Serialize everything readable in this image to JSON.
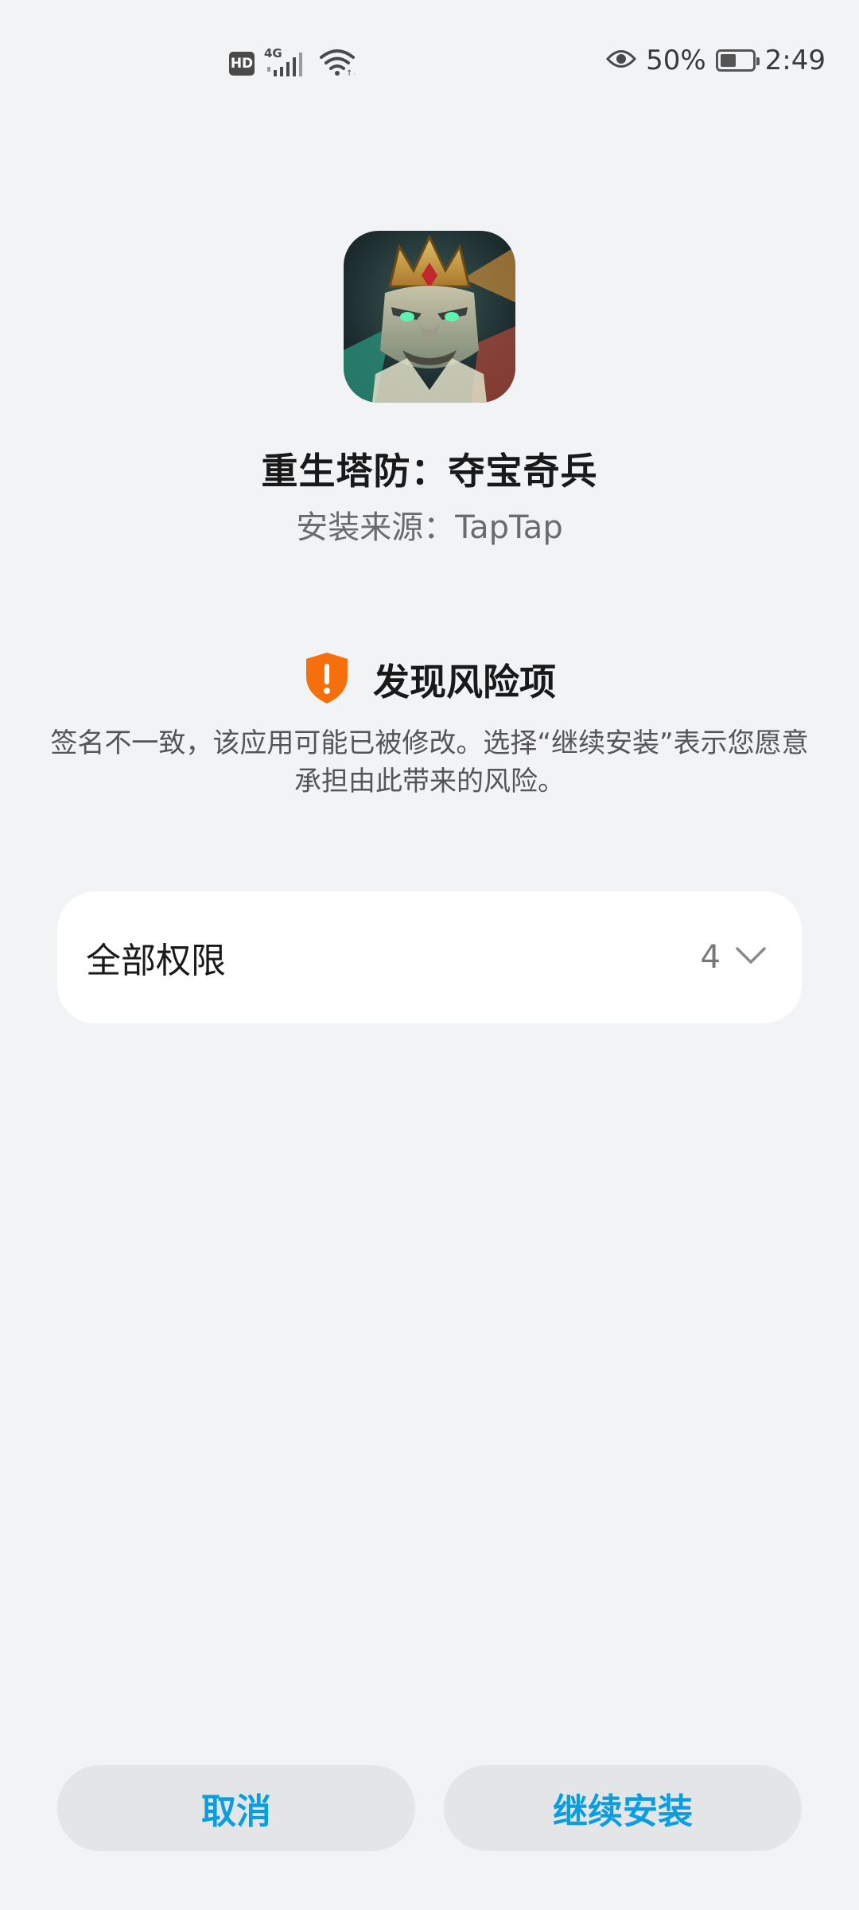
{
  "status_bar": {
    "hd_label": "HD",
    "network_label": "4G",
    "battery_percent": "50%",
    "battery_level": 0.5,
    "time": "2:49",
    "icons": [
      "hd-icon",
      "signal-icon",
      "wifi-icon",
      "eye-icon",
      "battery-icon"
    ]
  },
  "app": {
    "name": "重生塔防：夺宝奇兵",
    "source": "安装来源：TapTap",
    "icon": "app-icon"
  },
  "risk": {
    "title": "发现风险项",
    "description": "签名不一致，该应用可能已被修改。选择“继续安装”表示您愿意承担由此带来的风险。",
    "icon": "shield-warning-icon",
    "icon_color": "#f56f0c"
  },
  "permissions": {
    "label": "全部权限",
    "count": "4",
    "icon": "chevron-down-icon"
  },
  "buttons": {
    "cancel": "取消",
    "continue": "继续安装",
    "accent_color": "#0a9ee0"
  }
}
